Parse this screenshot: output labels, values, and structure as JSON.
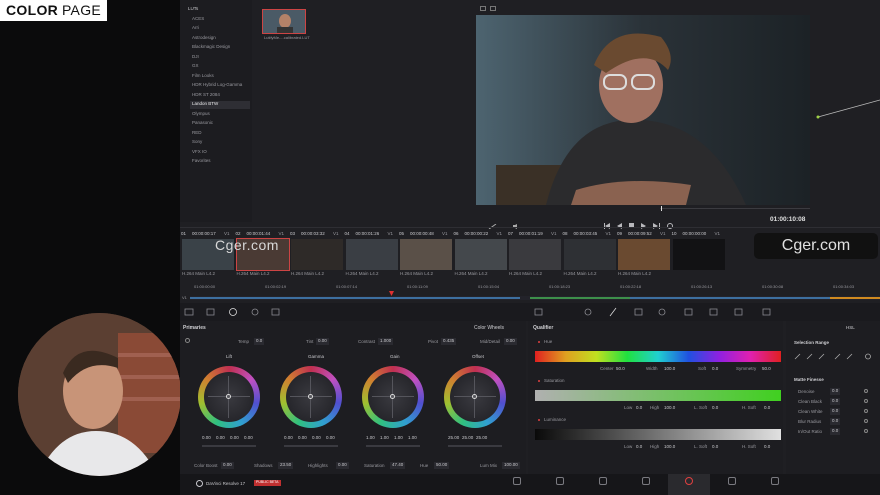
{
  "badge": {
    "bold": "COLOR",
    "light": "PAGE"
  },
  "lut_browser": {
    "items": [
      "LUTs",
      "ACES",
      "Arri",
      "Astrodesign",
      "Blackmagic Design",
      "DJI",
      "GX",
      "Film Looks",
      "HDR Hybrid Log-Gamma",
      "HDR ST 2084",
      "Landon BTW",
      "Olympus",
      "Panasonic",
      "RED",
      "Sony",
      "VFX IO",
      "Favorites"
    ],
    "selected_index": 10,
    "thumb_label": "LutifyMe-...calibrated.LUT"
  },
  "viewer": {
    "timecode": "01:00:10:08"
  },
  "clips": [
    {
      "num": "01",
      "tc": "00:00:00:17",
      "track": "V1",
      "codec": "H.264 Main L4.2"
    },
    {
      "num": "02",
      "tc": "00:00:01:44",
      "track": "V1",
      "codec": "H.264 Main L4.2"
    },
    {
      "num": "03",
      "tc": "00:00:03:32",
      "track": "V1",
      "codec": "H.264 Main L4.2"
    },
    {
      "num": "04",
      "tc": "00:00:01:26",
      "track": "V1",
      "codec": "H.264 Main L4.2"
    },
    {
      "num": "05",
      "tc": "00:00:00:48",
      "track": "V1",
      "codec": "H.264 Main L4.2"
    },
    {
      "num": "06",
      "tc": "00:00:00:22",
      "track": "V1",
      "codec": "H.264 Main L4.2"
    },
    {
      "num": "07",
      "tc": "00:00:01:19",
      "track": "V1",
      "codec": "H.264 Main L4.2"
    },
    {
      "num": "08",
      "tc": "00:00:03:45",
      "track": "V1",
      "codec": "H.264 Main L4.2"
    },
    {
      "num": "09",
      "tc": "00:00:09:52",
      "track": "V1",
      "codec": "H.264 Main L4.2"
    },
    {
      "num": "10",
      "tc": "00:00:00:00",
      "track": "V1",
      "codec": ""
    }
  ],
  "ruler": [
    "01:00:00:00",
    "01:00:02:19",
    "01:00:07:14",
    "01:00:11:09",
    "01:00:15:04",
    "01:00:18:23",
    "01:00:22:18",
    "01:00:26:13",
    "01:00:30:08",
    "01:00:34:03"
  ],
  "primaries": {
    "title": "Primaries",
    "mode": "Color Wheels",
    "temp_label": "Temp",
    "temp": "0.0",
    "tint_label": "Tint",
    "tint": "0.00",
    "contrast_label": "Contrast",
    "contrast": "1.000",
    "pivot_label": "Pivot",
    "pivot": "0.435",
    "middetail_label": "Mid/Detail",
    "middetail": "0.00",
    "wheels": [
      {
        "name": "Lift",
        "values": [
          "0.00",
          "0.00",
          "0.00",
          "0.00"
        ]
      },
      {
        "name": "Gamma",
        "values": [
          "0.00",
          "0.00",
          "0.00",
          "0.00"
        ]
      },
      {
        "name": "Gain",
        "values": [
          "1.00",
          "1.00",
          "1.00",
          "1.00"
        ]
      },
      {
        "name": "Offset",
        "values": [
          "25.00",
          "25.00",
          "25.00",
          ""
        ]
      }
    ],
    "bottom": [
      {
        "label": "Color Boost",
        "value": "0.00"
      },
      {
        "label": "Shadows",
        "value": "23.50"
      },
      {
        "label": "Highlights",
        "value": "0.00"
      },
      {
        "label": "Saturation",
        "value": "47.40"
      },
      {
        "label": "Hue",
        "value": "50.00"
      },
      {
        "label": "Lum Mix",
        "value": "100.00"
      }
    ]
  },
  "qualifier": {
    "title": "Qualifier",
    "hue": {
      "label": "Hue",
      "center_label": "Center",
      "center": "50.0",
      "width_label": "Width",
      "width": "100.0",
      "soft_label": "Soft",
      "soft": "0.0",
      "sym_label": "Symmetry",
      "sym": "50.0"
    },
    "sat": {
      "label": "Saturation",
      "low_label": "Low",
      "low": "0.0",
      "high_label": "High",
      "high": "100.0",
      "lsoft_label": "L. Soft",
      "lsoft": "0.0",
      "hsoft_label": "H. Soft",
      "hsoft": "0.0"
    },
    "lum": {
      "label": "Luminance",
      "low_label": "Low",
      "low": "0.0",
      "high_label": "High",
      "high": "100.0",
      "lsoft_label": "L. Soft",
      "lsoft": "0.0",
      "hsoft_label": "H. Soft",
      "hsoft": "0.0"
    }
  },
  "selection": {
    "title": "Selection Range",
    "hsl": "HSL",
    "matte": "Matte Finesse",
    "rows": [
      {
        "label": "Denoise",
        "value": "0.0"
      },
      {
        "label": "Clean Black",
        "value": "0.0"
      },
      {
        "label": "Clean White",
        "value": "0.0"
      },
      {
        "label": "Blur Radius",
        "value": "0.0"
      },
      {
        "label": "In/Out Ratio",
        "value": "0.0"
      }
    ]
  },
  "app": {
    "name": "DaVinci Resolve 17",
    "beta": "PUBLIC BETA"
  },
  "nav": [
    {
      "label": "Media",
      "active": false
    },
    {
      "label": "Cut",
      "active": false
    },
    {
      "label": "Edit",
      "active": false
    },
    {
      "label": "Fusion",
      "active": false
    },
    {
      "label": "Color",
      "active": true
    },
    {
      "label": "Fairlight",
      "active": false
    },
    {
      "label": "Deliver",
      "active": false
    }
  ],
  "watermark": "Cger.com"
}
